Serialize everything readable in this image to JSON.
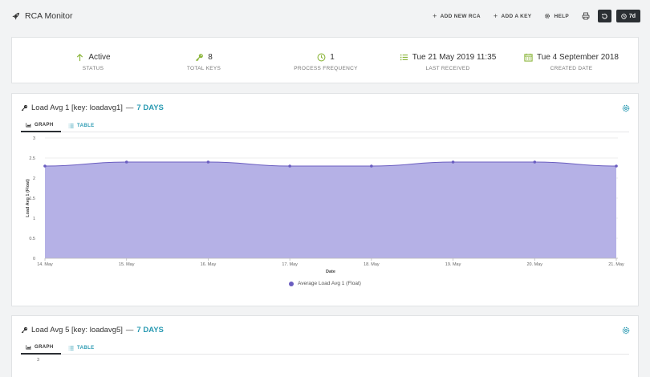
{
  "app": {
    "title": "RCA Monitor"
  },
  "nav": {
    "add_rca": "ADD NEW RCA",
    "add_key": "ADD A KEY",
    "help": "HELP",
    "range": "7d"
  },
  "stats": [
    {
      "value": "Active",
      "label": "STATUS",
      "icon": "arrow-up-icon"
    },
    {
      "value": "8",
      "label": "TOTAL KEYS",
      "icon": "key-icon"
    },
    {
      "value": "1",
      "label": "PROCESS FREQUENCY",
      "icon": "clock-icon"
    },
    {
      "value": "Tue 21 May 2019 11:35",
      "label": "LAST RECEIVED",
      "icon": "list-icon"
    },
    {
      "value": "Tue 4 September 2018",
      "label": "CREATED DATE",
      "icon": "calendar-icon"
    }
  ],
  "colors": {
    "accent": "#2a9ab2",
    "green": "#8cb63c",
    "series": "#6a5dc0",
    "area": "#b5b1e6"
  },
  "panels": [
    {
      "title": "Load Avg 1 [key: loadavg1]",
      "dash": "—",
      "range_label": "7 DAYS",
      "tabs": {
        "graph": "GRAPH",
        "table": "TABLE"
      },
      "legend": "Average Load Avg 1 (Float)"
    },
    {
      "title": "Load Avg 5 [key: loadavg5]",
      "dash": "—",
      "range_label": "7 DAYS",
      "tabs": {
        "graph": "GRAPH",
        "table": "TABLE"
      },
      "first_tick": "3"
    }
  ],
  "chart_data": {
    "type": "area",
    "title": "Load Avg 1 [key: loadavg1]",
    "xlabel": "Date",
    "ylabel": "Load Avg 1 (Float)",
    "categories": [
      "14. May",
      "15. May",
      "16. May",
      "17. May",
      "18. May",
      "19. May",
      "20. May",
      "21. May"
    ],
    "y_ticks": [
      "0",
      "0.5",
      "1",
      "1.5",
      "2",
      "2.5",
      "3"
    ],
    "ylim": [
      0,
      3
    ],
    "grid": true,
    "legend_position": "bottom",
    "series": [
      {
        "name": "Average Load Avg 1 (Float)",
        "values": [
          2.3,
          2.4,
          2.4,
          2.3,
          2.3,
          2.4,
          2.4,
          2.3
        ]
      }
    ]
  }
}
